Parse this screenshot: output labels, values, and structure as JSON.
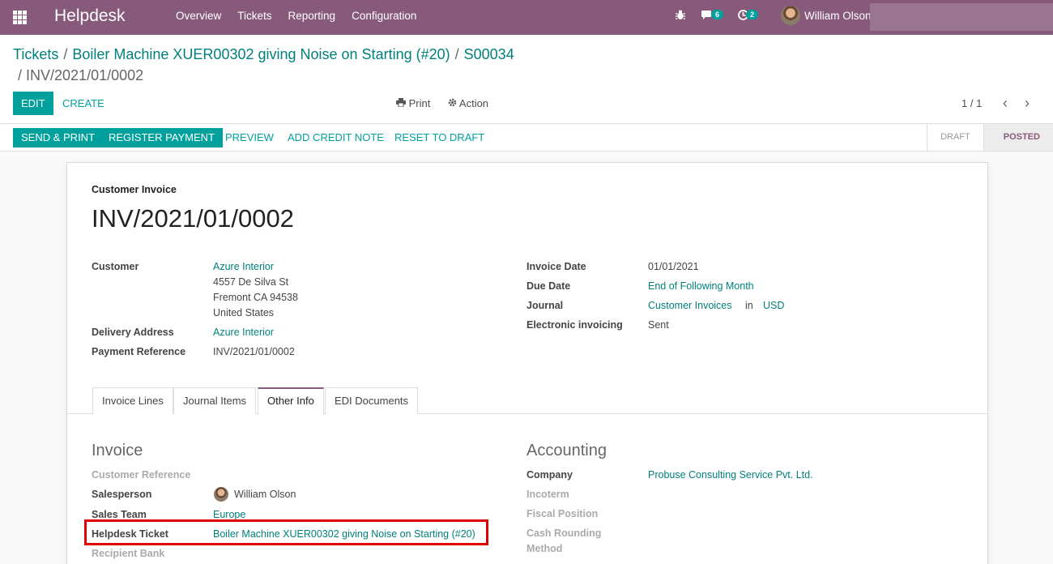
{
  "navbar": {
    "app_title": "Helpdesk",
    "menu": [
      "Overview",
      "Tickets",
      "Reporting",
      "Configuration"
    ],
    "chat_count": "6",
    "activity_count": "2",
    "user_name": "William Olson"
  },
  "breadcrumb": {
    "items": [
      "Tickets",
      "Boiler Machine XUER00302 giving Noise on Starting (#20)",
      "S00034"
    ],
    "current": "INV/2021/01/0002"
  },
  "controls": {
    "edit": "EDIT",
    "create": "CREATE",
    "print": "Print",
    "action": "Action",
    "pager": "1 / 1"
  },
  "statusbar": {
    "buttons": [
      "SEND & PRINT",
      "REGISTER PAYMENT",
      "PREVIEW",
      "ADD CREDIT NOTE",
      "RESET TO DRAFT"
    ],
    "stages": [
      "DRAFT",
      "POSTED"
    ]
  },
  "invoice": {
    "type_label": "Customer Invoice",
    "name": "INV/2021/01/0002",
    "customer_label": "Customer",
    "customer_name": "Azure Interior",
    "address": [
      "4557 De Silva St",
      "Fremont CA 94538",
      "United States"
    ],
    "delivery_label": "Delivery Address",
    "delivery_value": "Azure Interior",
    "payment_ref_label": "Payment Reference",
    "payment_ref_value": "INV/2021/01/0002",
    "invoice_date_label": "Invoice Date",
    "invoice_date_value": "01/01/2021",
    "due_date_label": "Due Date",
    "due_date_value": "End of Following Month",
    "journal_label": "Journal",
    "journal_value": "Customer Invoices",
    "journal_in": "in",
    "journal_currency": "USD",
    "einvoicing_label": "Electronic invoicing",
    "einvoicing_value": "Sent"
  },
  "tabs": [
    "Invoice Lines",
    "Journal Items",
    "Other Info",
    "EDI Documents"
  ],
  "other_info": {
    "invoice_title": "Invoice",
    "customer_reference_label": "Customer Reference",
    "salesperson_label": "Salesperson",
    "salesperson_value": "William Olson",
    "sales_team_label": "Sales Team",
    "sales_team_value": "Europe",
    "helpdesk_ticket_label": "Helpdesk Ticket",
    "helpdesk_ticket_value": "Boiler Machine XUER00302 giving Noise on Starting (#20)",
    "recipient_bank_label": "Recipient Bank",
    "accounting_title": "Accounting",
    "company_label": "Company",
    "company_value": "Probuse Consulting Service Pvt. Ltd.",
    "incoterm_label": "Incoterm",
    "fiscal_position_label": "Fiscal Position",
    "cash_rounding_label": "Cash Rounding",
    "cash_rounding_label2": "Method"
  },
  "icons": {
    "apps": "apps-grid-icon",
    "bug": "bug-icon",
    "chat": "chat-icon",
    "activity": "clock-icon",
    "print": "print-icon",
    "action": "gear-icon",
    "prev": "chevron-left-icon",
    "next": "chevron-right-icon"
  },
  "colors": {
    "navbar": "#875a7b",
    "primary": "#00a09d",
    "link": "#00807c",
    "highlight": "#e00000"
  }
}
